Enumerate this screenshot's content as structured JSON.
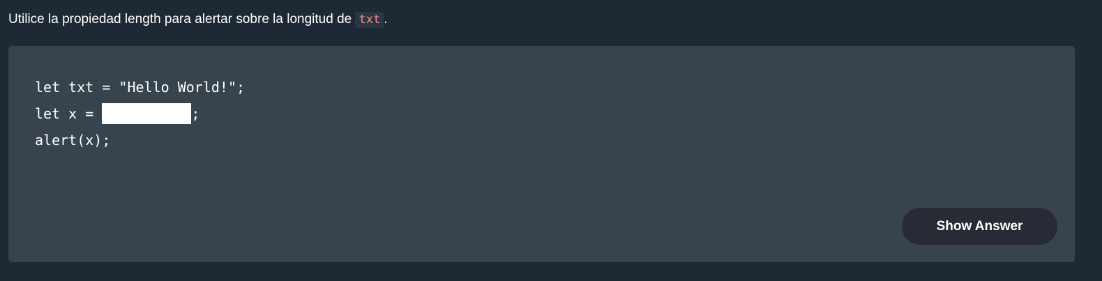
{
  "instruction": {
    "text_before": "Utilice la propiedad length para alertar sobre la longitud de ",
    "code_word": "txt",
    "text_after": "."
  },
  "code": {
    "line1": "let txt = \"Hello World!\";",
    "line2_prefix": "let x = ",
    "line2_input_value": "",
    "line2_suffix": ";",
    "line3": "alert(x);"
  },
  "buttons": {
    "show_answer_label": "Show Answer"
  },
  "colors": {
    "page_background": "#1d2a35",
    "panel_background": "#38444d",
    "button_background": "#282a35",
    "inline_code_color": "#ff8a8a"
  }
}
